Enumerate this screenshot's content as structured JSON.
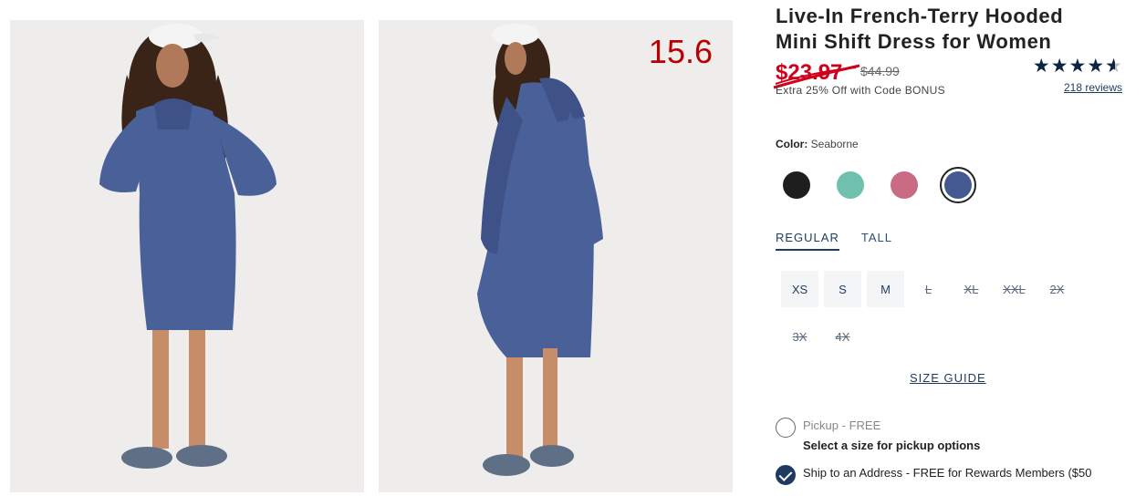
{
  "overlay": {
    "number": "15.6"
  },
  "images": [
    {
      "alt_name": "product-photo-front"
    },
    {
      "alt_name": "product-photo-side"
    }
  ],
  "product": {
    "title": "Live-In French-Terry Hooded Mini Shift Dress for Women",
    "sale_price": "$23.97",
    "original_price": "$44.99",
    "promo": "Extra 25% Off with Code BONUS",
    "rating": 4.5,
    "reviews": "218 reviews"
  },
  "color": {
    "label": "Color:",
    "selected": "Seaborne",
    "swatches": [
      {
        "name": "black",
        "hex": "#1e1e1e"
      },
      {
        "name": "teal",
        "hex": "#6fc1ae"
      },
      {
        "name": "rose",
        "hex": "#c86b83"
      },
      {
        "name": "seaborne",
        "hex": "#43598f",
        "selected": true
      }
    ]
  },
  "fit": {
    "tabs": [
      {
        "label": "REGULAR",
        "active": true
      },
      {
        "label": "TALL",
        "active": false
      }
    ]
  },
  "sizes": [
    {
      "label": "XS",
      "available": true
    },
    {
      "label": "S",
      "available": true
    },
    {
      "label": "M",
      "available": true
    },
    {
      "label": "L",
      "available": false
    },
    {
      "label": "XL",
      "available": false
    },
    {
      "label": "XXL",
      "available": false
    },
    {
      "label": "2X",
      "available": false
    },
    {
      "label": "3X",
      "available": false
    },
    {
      "label": "4X",
      "available": false
    }
  ],
  "size_guide": "SIZE GUIDE",
  "fulfillment": {
    "pickup_label": "Pickup - FREE",
    "pickup_sub": "Select a size for pickup options",
    "ship_label": "Ship to an Address - FREE for Rewards Members ($50"
  },
  "colors": {
    "sale": "#d0021b",
    "navy": "#1f3a5f",
    "overlay": "#b80000"
  }
}
